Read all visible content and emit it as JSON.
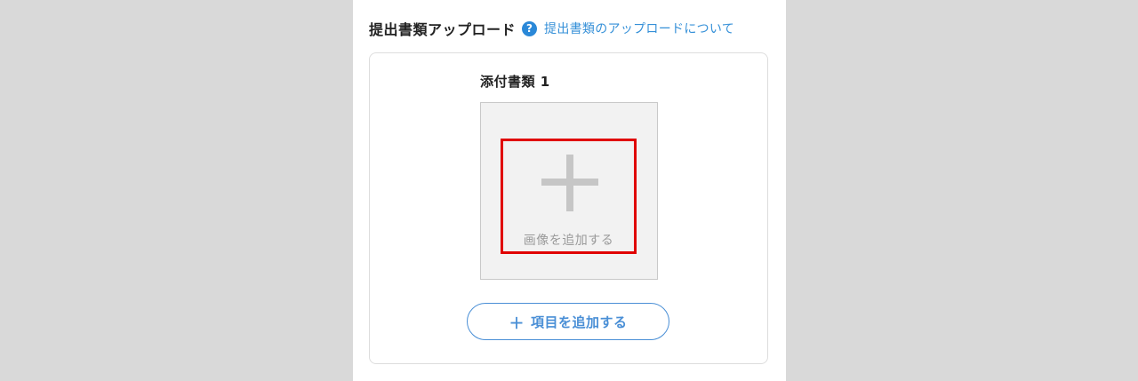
{
  "section": {
    "title": "提出書類アップロード",
    "help_icon": "?",
    "help_icon_name": "question-circle-icon",
    "help_link": "提出書類のアップロードについて"
  },
  "upload": {
    "attachment_label": "添付書類 1",
    "plus_icon_name": "plus-icon",
    "add_image_label": "画像を追加する"
  },
  "actions": {
    "add_item_plus": "＋",
    "add_item_label": "項目を追加する"
  },
  "colors": {
    "accent": "#2a88d8",
    "button_border": "#4a8fd6",
    "highlight": "#e00000",
    "dropzone_bg": "#f2f2f2",
    "page_bg": "#d9d9d9"
  }
}
